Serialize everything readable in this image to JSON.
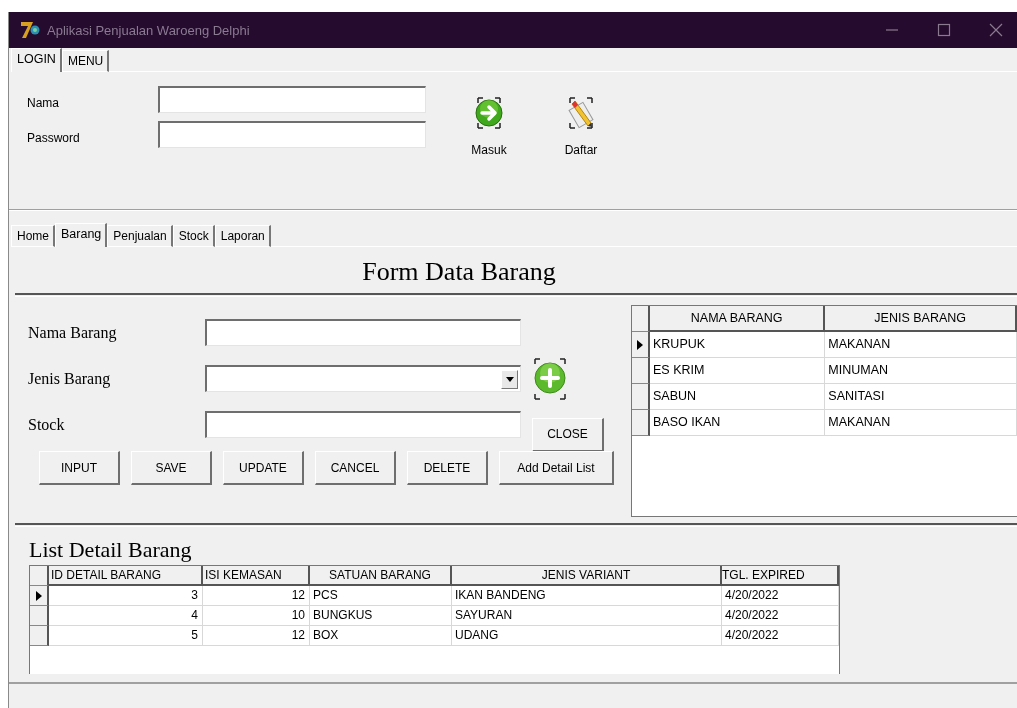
{
  "window": {
    "title": "Aplikasi Penjualan Waroeng Delphi"
  },
  "login_tabs": [
    {
      "label": "LOGIN",
      "selected": true
    },
    {
      "label": "MENU",
      "selected": false
    }
  ],
  "login": {
    "fields": [
      {
        "label": "Nama"
      },
      {
        "label": "Password"
      }
    ],
    "buttons": [
      {
        "kind": "enter",
        "label": "Masuk"
      },
      {
        "kind": "edit",
        "label": "Daftar"
      }
    ]
  },
  "main_tabs": [
    {
      "label": "Home",
      "selected": false
    },
    {
      "label": "Barang",
      "selected": true
    },
    {
      "label": "Penjualan",
      "selected": false
    },
    {
      "label": "Stock",
      "selected": false
    },
    {
      "label": "Laporan",
      "selected": false
    }
  ],
  "form": {
    "title": "Form Data Barang",
    "fields": [
      {
        "label": "Nama Barang",
        "kind": "text"
      },
      {
        "label": "Jenis Barang",
        "kind": "combo"
      },
      {
        "label": "Stock",
        "kind": "text"
      }
    ],
    "close_button": "CLOSE",
    "buttons": [
      "INPUT",
      "SAVE",
      "UPDATE",
      "CANCEL",
      "DELETE",
      "Add Detail List"
    ]
  },
  "items_table": {
    "columns": [
      "NAMA BARANG",
      "JENIS BARANG"
    ],
    "rows": [
      {
        "cells": [
          "KRUPUK",
          "MAKANAN"
        ],
        "selected": true
      },
      {
        "cells": [
          "ES KRIM",
          "MINUMAN"
        ],
        "selected": false
      },
      {
        "cells": [
          "SABUN",
          "SANITASI"
        ],
        "selected": false
      },
      {
        "cells": [
          "BASO IKAN",
          "MAKANAN"
        ],
        "selected": false
      }
    ]
  },
  "detail": {
    "title": "List Detail Barang",
    "columns": [
      "ID DETAIL BARANG",
      "ISI KEMASAN",
      "SATUAN BARANG",
      "JENIS VARIANT",
      "TGL. EXPIRED"
    ],
    "rows": [
      {
        "cells": [
          "3",
          "12",
          "PCS",
          "IKAN BANDENG",
          "4/20/2022"
        ],
        "selected": true
      },
      {
        "cells": [
          "4",
          "10",
          "BUNGKUS",
          "SAYURAN",
          "4/20/2022"
        ],
        "selected": false
      },
      {
        "cells": [
          "5",
          "12",
          "BOX",
          "UDANG",
          "4/20/2022"
        ],
        "selected": false
      }
    ]
  }
}
